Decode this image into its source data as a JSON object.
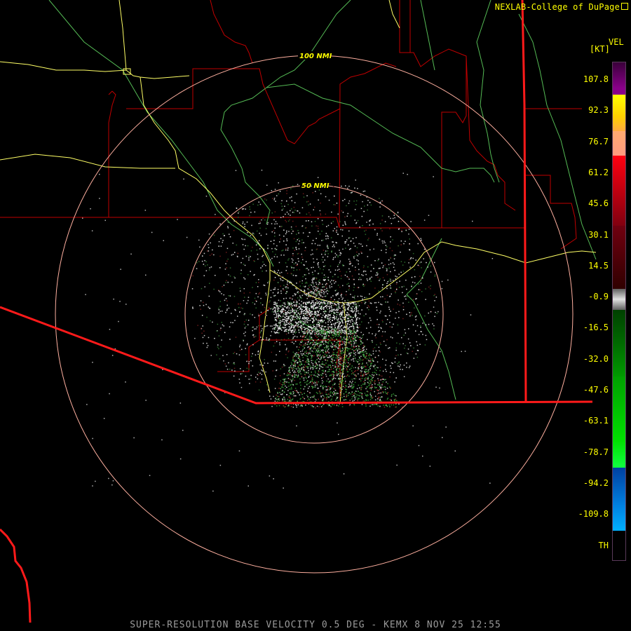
{
  "credit": "NEXLAB-College of DuPage",
  "credit_icon": "external-link-icon",
  "legend": {
    "product": "VEL",
    "unit": "[KT]",
    "ticks": [
      "107.8",
      "92.3",
      "76.7",
      "61.2",
      "45.6",
      "30.1",
      "14.5",
      "-0.9",
      "-16.5",
      "-32.0",
      "-47.6",
      "-63.1",
      "-78.7",
      "-94.2",
      "-109.8",
      "TH"
    ]
  },
  "rings": [
    {
      "label": "100 NMI"
    },
    {
      "label": "50 NMI"
    }
  ],
  "footer": "SUPER-RESOLUTION BASE VELOCITY 0.5 DEG - KEMX 8 NOV 25 12:55",
  "colors": {
    "background": "#000000",
    "text": "#ffff00",
    "county_lines": "#c00000",
    "border": "#ff2020",
    "roads": "#ffff66",
    "rivers": "#66cc66",
    "rings": "#ffb0a0"
  }
}
